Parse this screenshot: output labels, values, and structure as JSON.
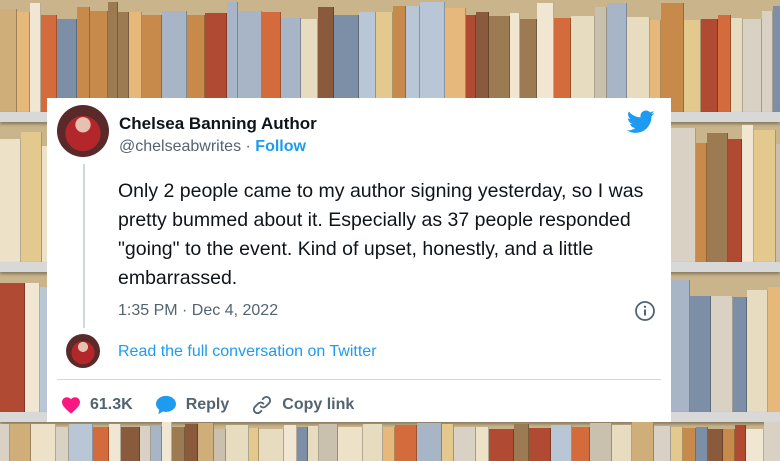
{
  "tweet": {
    "author_name": "Chelsea Banning Author",
    "handle": "@chelseabwrites",
    "separator": " · ",
    "follow_label": "Follow",
    "text": "Only 2 people came to my author signing yesterday, so I was pretty bummed about it. Especially as 37 people responded \"going\" to the event. Kind of upset, honestly, and a little embarrassed.",
    "timestamp": "1:35 PM · Dec 4, 2022",
    "read_conversation_label": "Read the full conversation on Twitter",
    "likes_count": "61.3K",
    "reply_label": "Reply",
    "copy_link_label": "Copy link"
  },
  "icons": {
    "brand": "twitter-bird-icon",
    "info": "info-icon",
    "like": "heart-icon",
    "reply": "speech-bubble-icon",
    "copy_link": "link-icon"
  },
  "colors": {
    "twitter_blue": "#1d9bf0",
    "heart": "#f91880",
    "reply_bubble": "#1d9bf0",
    "text": "#0f1419",
    "muted": "#536471"
  }
}
